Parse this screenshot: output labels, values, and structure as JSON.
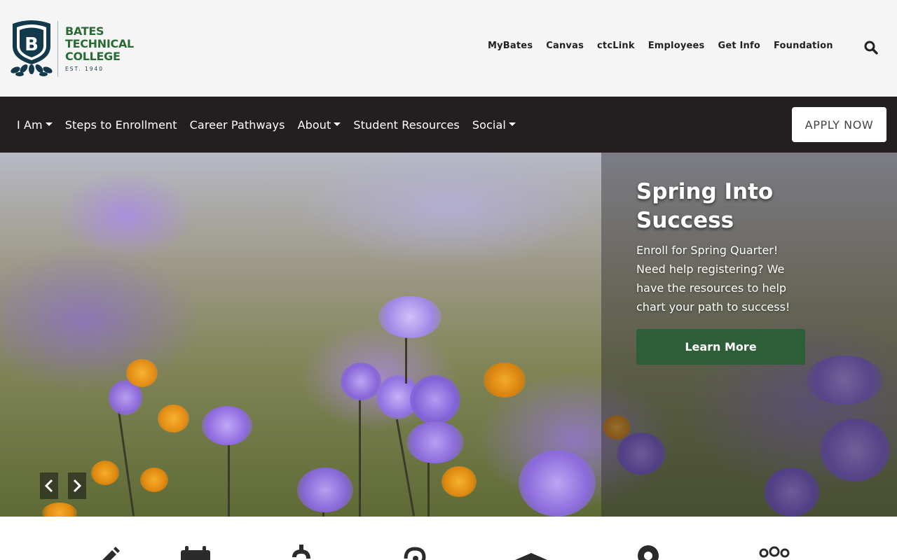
{
  "header": {
    "logo": {
      "lines": [
        "BATES",
        "TECHNICAL",
        "COLLEGE"
      ],
      "established": "EST. 1940",
      "shield_letter": "B"
    },
    "utility_links": [
      "MyBates",
      "Canvas",
      "ctcLink",
      "Employees",
      "Get Info",
      "Foundation"
    ],
    "search_icon": "search-icon"
  },
  "nav": {
    "items": [
      {
        "label": "I Am",
        "dropdown": true
      },
      {
        "label": "Steps to Enrollment",
        "dropdown": false
      },
      {
        "label": "Career Pathways",
        "dropdown": false
      },
      {
        "label": "About",
        "dropdown": true
      },
      {
        "label": "Student Resources",
        "dropdown": false
      },
      {
        "label": "Social",
        "dropdown": true
      }
    ],
    "apply_label": "APPLY NOW"
  },
  "hero": {
    "title": "Spring Into Success",
    "text": "Enroll for Spring Quarter! Need help registering? We have the resources to help chart your path to success!",
    "button_label": "Learn More",
    "prev_icon": "chevron-left-icon",
    "next_icon": "chevron-right-icon"
  },
  "quick_links": {
    "icons": [
      "pencil-icon",
      "calendar-icon",
      "dollar-icon",
      "question-icon",
      "graduation-cap-icon",
      "map-marker-icon",
      "users-icon"
    ]
  },
  "colors": {
    "brand_green": "#2a6a35",
    "brand_navy": "#13394d",
    "nav_bg": "#231f20",
    "button_green": "#2e5e37"
  }
}
